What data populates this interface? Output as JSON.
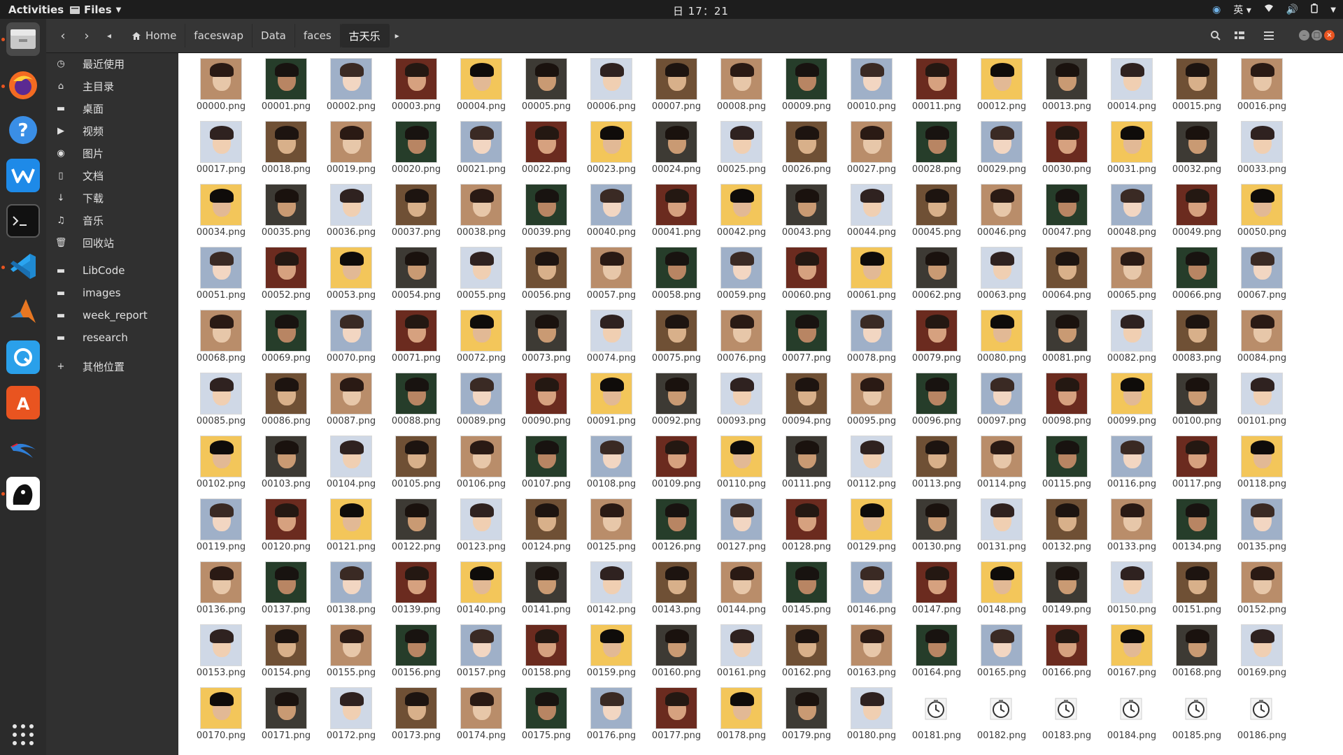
{
  "topbar": {
    "activities": "Activities",
    "app_menu": "Files",
    "clock": "日 17：21",
    "input_method": "英"
  },
  "header": {
    "breadcrumbs": [
      "Home",
      "faceswap",
      "Data",
      "faces",
      "古天乐"
    ]
  },
  "sidebar": {
    "items": [
      {
        "label": "最近使用",
        "icon": "clock-icon"
      },
      {
        "label": "主目录",
        "icon": "home-icon"
      },
      {
        "label": "桌面",
        "icon": "folder-icon"
      },
      {
        "label": "视频",
        "icon": "video-icon"
      },
      {
        "label": "图片",
        "icon": "camera-icon"
      },
      {
        "label": "文档",
        "icon": "document-icon"
      },
      {
        "label": "下载",
        "icon": "download-icon"
      },
      {
        "label": "音乐",
        "icon": "music-icon"
      },
      {
        "label": "回收站",
        "icon": "trash-icon"
      },
      {
        "label": "LibCode",
        "icon": "folder-icon"
      },
      {
        "label": "images",
        "icon": "folder-icon"
      },
      {
        "label": "week_report",
        "icon": "folder-icon"
      },
      {
        "label": "research",
        "icon": "folder-icon"
      },
      {
        "label": "其他位置",
        "icon": "plus-icon"
      }
    ]
  },
  "files": {
    "extension": ".png",
    "first_index": 0,
    "last_index": 186,
    "pending_from": 181
  }
}
